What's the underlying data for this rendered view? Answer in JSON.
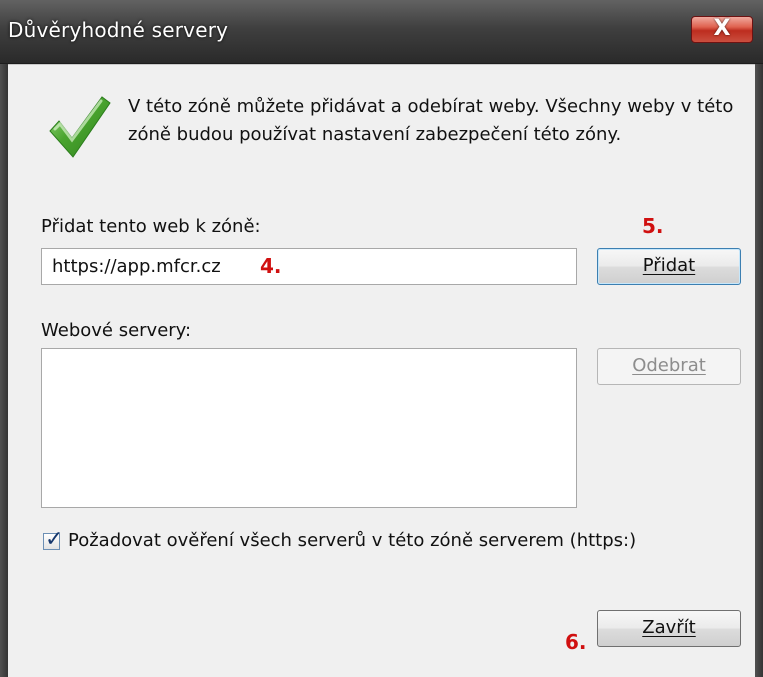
{
  "window": {
    "title": "Důvěryhodné servery",
    "close_glyph": "X"
  },
  "info": {
    "icon": "checkmark-icon",
    "text": "V této zóně můžete přidávat a odebírat weby. Všechny weby v této zóně budou používat nastavení zabezpečení této zóny."
  },
  "add_site": {
    "label": "Přidat tento web k zóně:",
    "value": "https://app.mfcr.cz",
    "button_label": "Přidat"
  },
  "servers": {
    "label": "Webové servery:",
    "items": [],
    "remove_button_label": "Odebrat"
  },
  "options": {
    "require_https_checked": true,
    "require_https_label": "Požadovat ověření všech serverů v této zóně serverem (https:)"
  },
  "footer": {
    "close_button_label": "Zavřít"
  },
  "annotations": {
    "step_4": "4.",
    "step_5": "5.",
    "step_6": "6."
  },
  "colors": {
    "annotation_red": "#d01010",
    "dialog_background": "#f0f0f0",
    "title_bar": "#333333",
    "close_button_red": "#c84030",
    "checkmark_green": "#4aa52f"
  }
}
